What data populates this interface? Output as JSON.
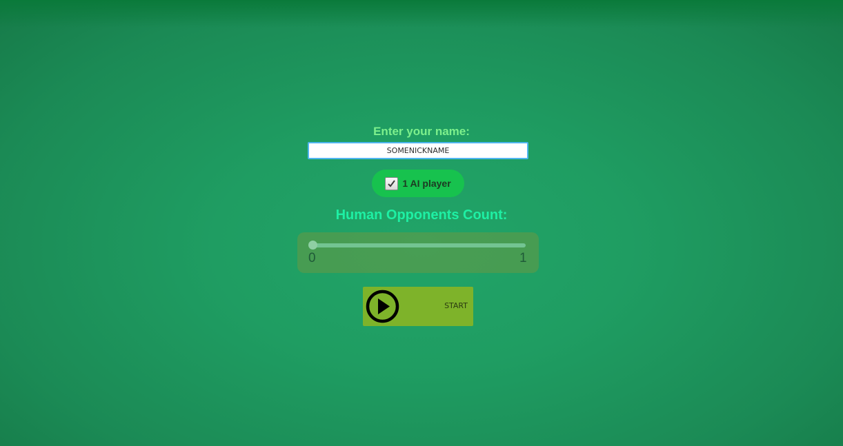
{
  "setup": {
    "name_label": "Enter your name:",
    "name_value": "SOMENICKNAME",
    "ai_toggle": {
      "checked": true,
      "label": "1 AI player"
    },
    "opponents_label": "Human Opponents Count:",
    "opponents_slider": {
      "min": "0",
      "max": "1",
      "value": 0
    },
    "start_label": "START"
  },
  "colors": {
    "background": "#1f9d62",
    "name_label": "#7df08c",
    "opponents_label": "#1ef0a4",
    "toggle": "#17c24e",
    "start_button": "#7eb32a",
    "input_border": "#4fb6f0"
  },
  "icons": {
    "checkbox": "checkbox-checked-icon",
    "start": "play-circle-icon"
  }
}
